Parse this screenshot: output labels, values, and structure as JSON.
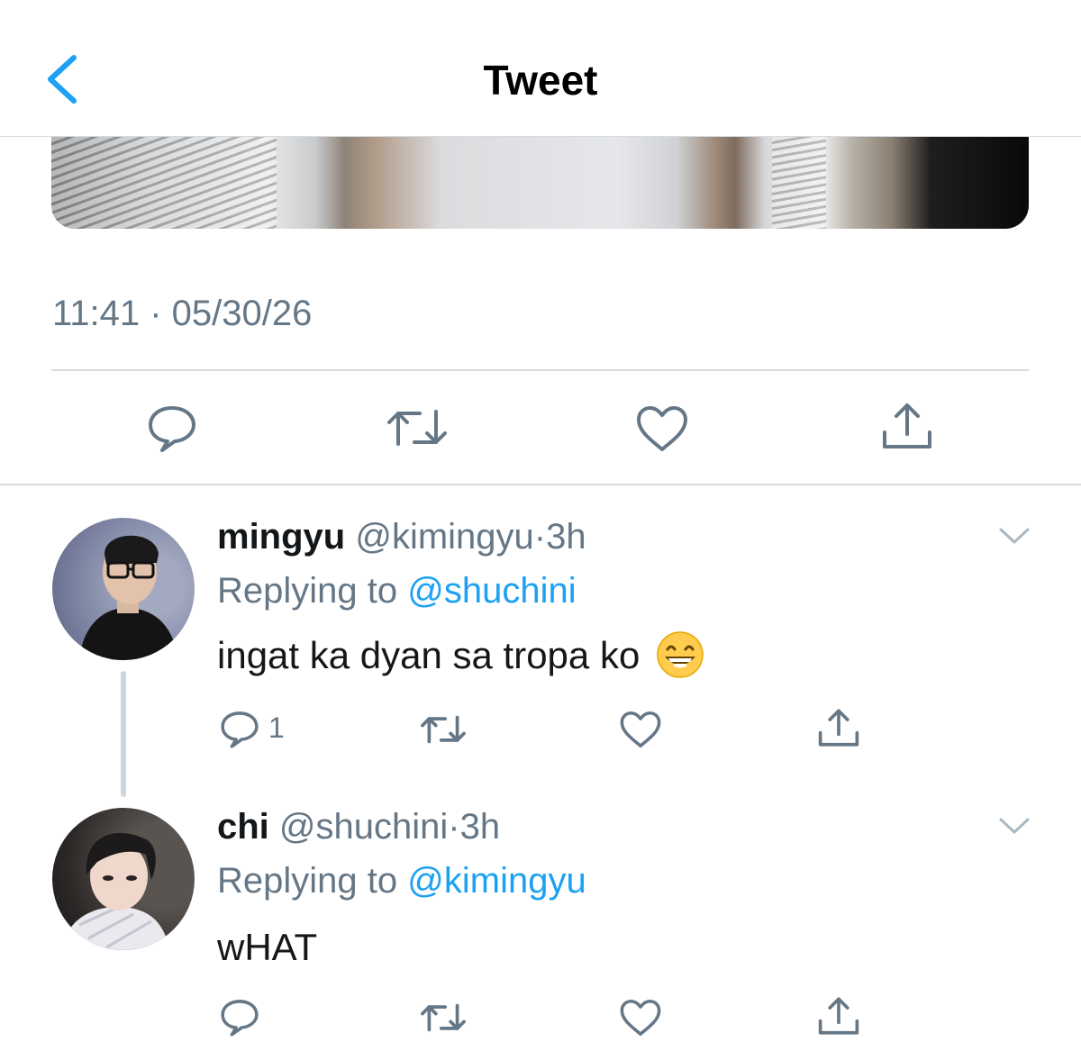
{
  "header": {
    "title": "Tweet",
    "back_icon": "chevron-left-icon"
  },
  "tweet": {
    "timestamp": "11:41 · 05/30/26",
    "actions": [
      "reply-icon",
      "retweet-icon",
      "like-icon",
      "share-icon"
    ]
  },
  "replies": [
    {
      "name": "mingyu",
      "handle": "@kimingyu",
      "sep": "·",
      "time": "3h",
      "replying_prefix": "Replying to",
      "replying_to": "@shuchini",
      "text": "ingat ka dyan sa tropa ko",
      "emoji": "grinning-face-icon",
      "reply_count": "1"
    },
    {
      "name": "chi",
      "handle": "@shuchini",
      "sep": "·",
      "time": "3h",
      "replying_prefix": "Replying to",
      "replying_to": "@kimingyu",
      "text": "wHAT",
      "reply_count": ""
    }
  ],
  "colors": {
    "accent": "#1da1f2",
    "icon": "#657786",
    "text": "#14171a",
    "divider": "#d6dbdf"
  }
}
